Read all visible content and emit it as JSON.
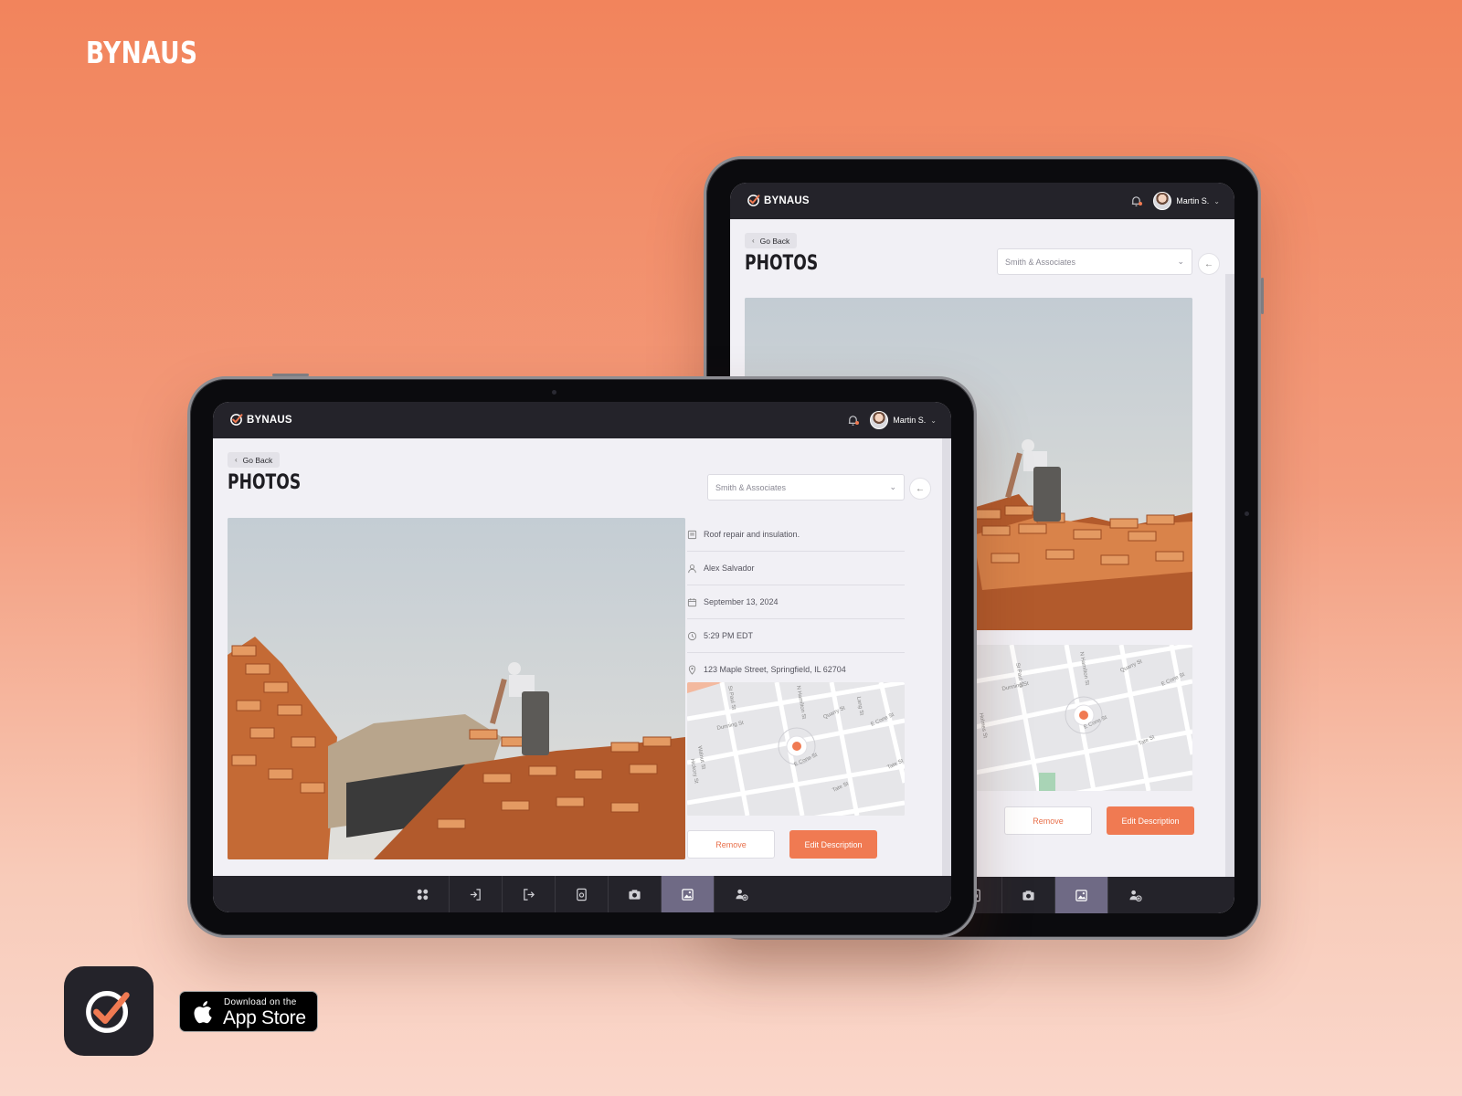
{
  "brand": {
    "title": "BYNAUS",
    "logo_text": "BYNAUS"
  },
  "header": {
    "user_name": "Martin S."
  },
  "page": {
    "go_back_label": "Go Back",
    "title": "PHOTOS",
    "client_select_value": "Smith & Associates"
  },
  "details": {
    "description": "Roof repair and insulation.",
    "person": "Alex Salvador",
    "date": "September 13, 2024",
    "time": "5:29 PM EDT",
    "address": "123 Maple Street, Springfield, IL 62704"
  },
  "map": {
    "streets": [
      "St Paul St",
      "Dunning St",
      "Walnut St",
      "Hickory St",
      "N Hamilton St",
      "Quarry St",
      "E Cone St",
      "Lang St",
      "Tate St",
      "Holmes St"
    ]
  },
  "actions": {
    "remove_label": "Remove",
    "edit_label": "Edit Description"
  },
  "tabs": [
    {
      "icon": "dashboard-icon"
    },
    {
      "icon": "check-in-icon"
    },
    {
      "icon": "check-out-icon"
    },
    {
      "icon": "document-icon"
    },
    {
      "icon": "camera-icon"
    },
    {
      "icon": "photos-icon",
      "active": true
    },
    {
      "icon": "add-user-icon"
    }
  ],
  "store_badge": {
    "small_text": "Download on the",
    "big_text": "App Store"
  },
  "colors": {
    "accent": "#f07a52",
    "dark": "#24232a",
    "active_tab": "#6f6a85",
    "screen_bg": "#f1f0f5"
  }
}
